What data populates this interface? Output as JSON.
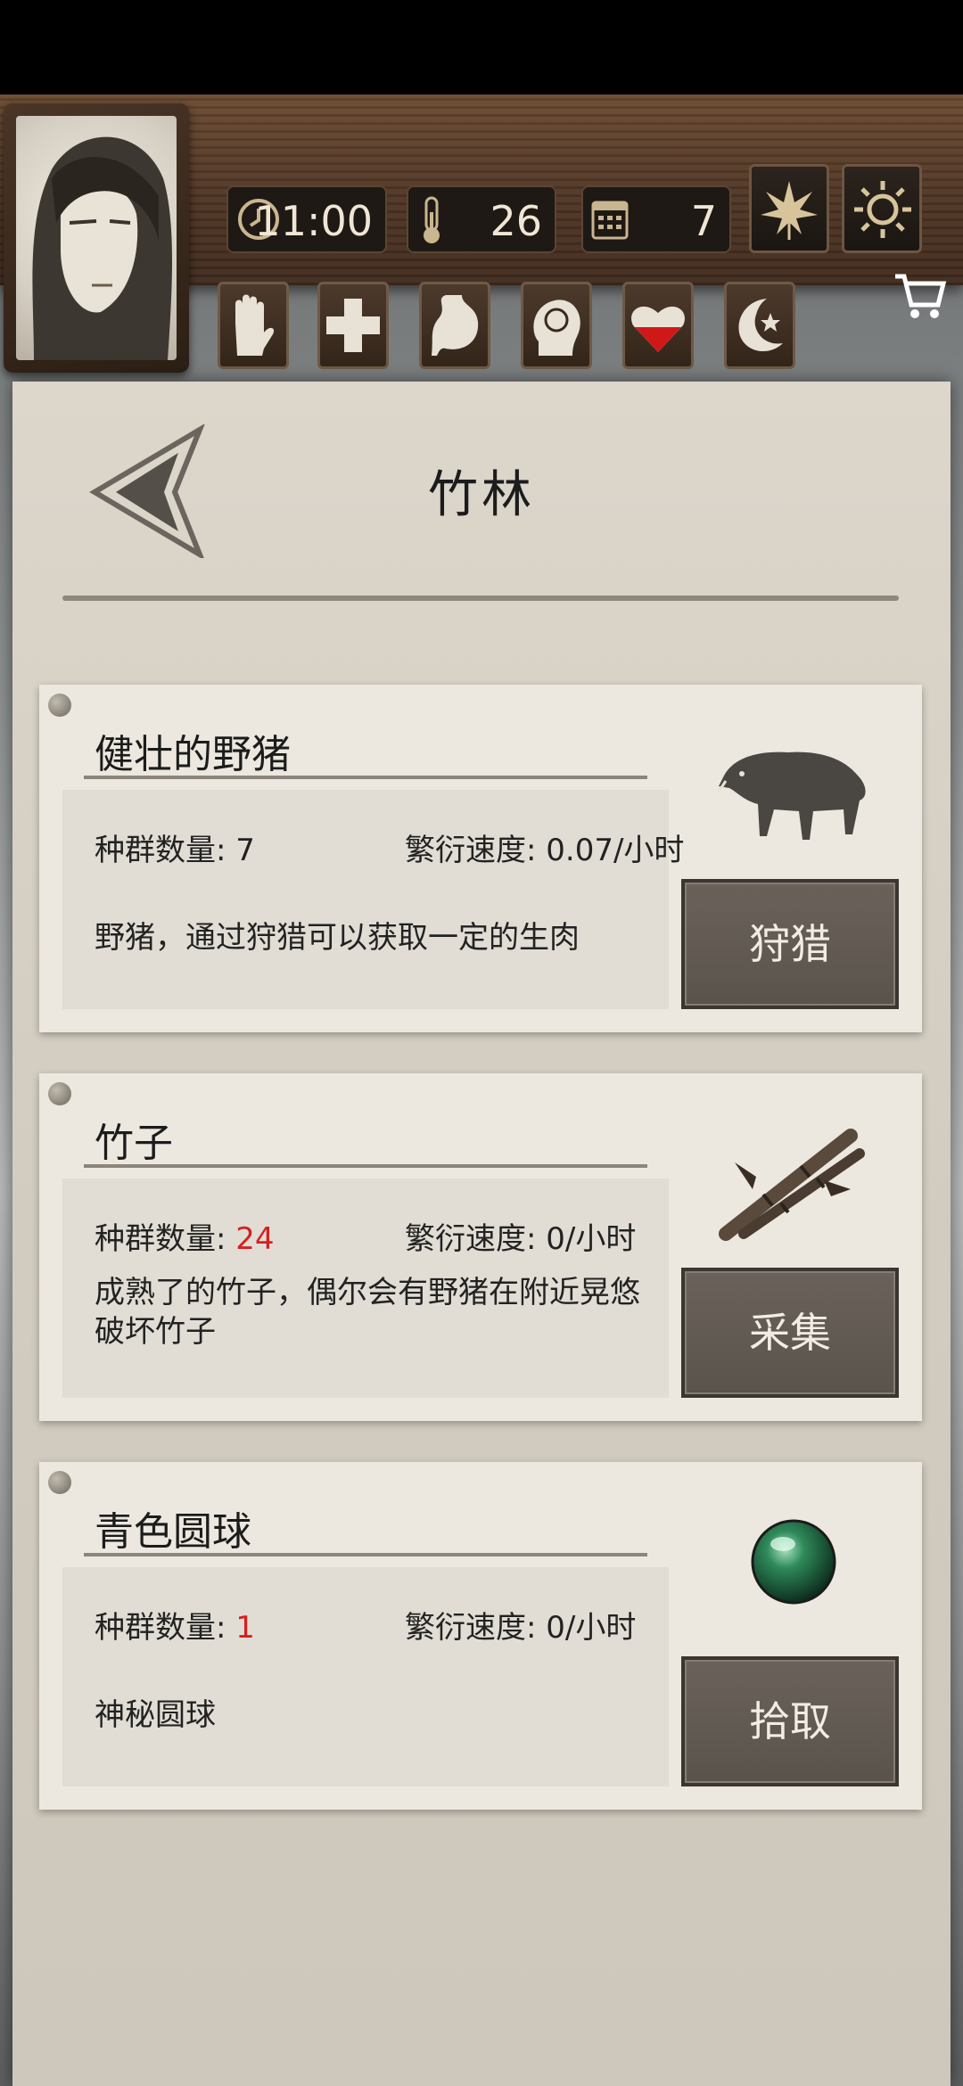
{
  "hud": {
    "time": "11:00",
    "temperature": "26",
    "day": "7",
    "season_icon": "leaf-icon",
    "weather_icon": "sun-icon",
    "status_icons": [
      "hand-icon",
      "health-cross-icon",
      "stomach-icon",
      "mind-icon",
      "heart-icon",
      "moon-icon"
    ]
  },
  "location": {
    "title": "竹林"
  },
  "labels": {
    "population": "种群数量: ",
    "rate_label": "繁衍速度: "
  },
  "resources": [
    {
      "name": "健壮的野猪",
      "population": "7",
      "population_highlight": false,
      "rate": "0.07/小时",
      "description": "野猪，通过狩猎可以获取一定的生肉",
      "action": "狩猎",
      "icon": "boar-icon"
    },
    {
      "name": "竹子",
      "population": "24",
      "population_highlight": true,
      "rate": "0/小时",
      "description": "成熟了的竹子，偶尔会有野猪在附近晃悠破坏竹子",
      "action": "采集",
      "icon": "bamboo-icon"
    },
    {
      "name": "青色圆球",
      "population": "1",
      "population_highlight": true,
      "rate": "0/小时",
      "description": "神秘圆球",
      "action": "拾取",
      "icon": "green-orb-icon"
    }
  ],
  "colors": {
    "highlight": "#d42020",
    "panel": "#d6d0c5",
    "wood": "#4f3524"
  }
}
